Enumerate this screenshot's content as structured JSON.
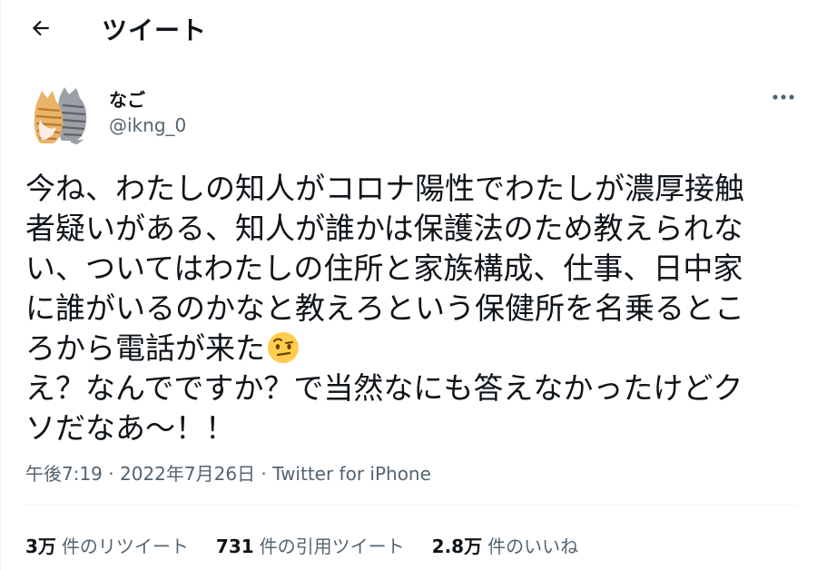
{
  "header": {
    "title": "ツイート"
  },
  "author": {
    "name": "なご",
    "handle": "@ikng_0"
  },
  "tweet": {
    "lines": [
      "今ね、わたしの知人がコロナ陽性でわたしが濃厚接触",
      "者疑いがある、知人が誰かは保護法のため教えられな",
      "い、ついてはわたしの住所と家族構成、仕事、日中家",
      "に誰がいるのかなと教えろという保健所を名乗るとこ",
      "ろから電話が来た",
      "え？なんでですか？で当然なにも答えなかったけどク",
      "ソだなあ〜！！"
    ],
    "emoji": "face-with-raised-eyebrow"
  },
  "meta": {
    "time": "午後7:19",
    "sep1": " · ",
    "date": "2022年7月26日",
    "sep2": " · ",
    "source": "Twitter for iPhone"
  },
  "stats": {
    "retweets": {
      "count": "3万",
      "label": "件のリツイート"
    },
    "quotes": {
      "count": "731",
      "label": "件の引用ツイート"
    },
    "likes": {
      "count": "2.8万",
      "label": "件のいいね"
    }
  },
  "icons": {
    "back": "arrow-left-icon",
    "more": "more-dots-icon"
  },
  "colors": {
    "text": "#0f1419",
    "secondary": "#536471",
    "divider": "#eff3f4"
  }
}
